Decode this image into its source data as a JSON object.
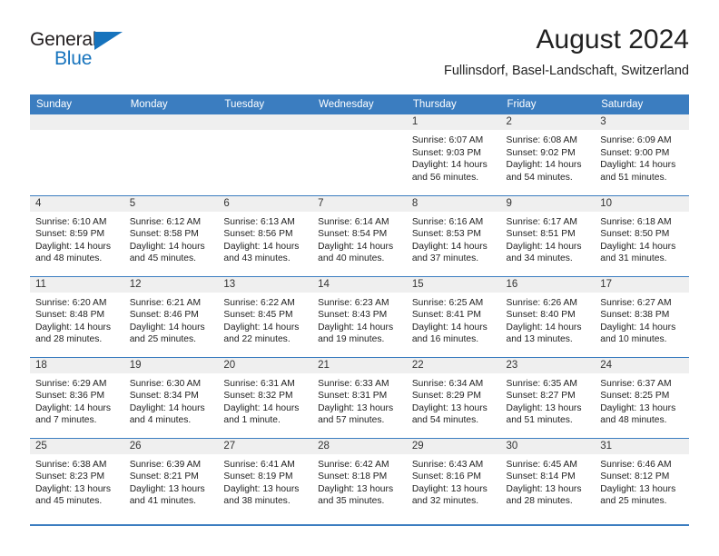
{
  "brand": {
    "name_part1": "General",
    "name_part2": "Blue",
    "triangle_color": "#1673bd"
  },
  "header": {
    "title": "August 2024",
    "subtitle": "Fullinsdorf, Basel-Landschaft, Switzerland"
  },
  "theme": {
    "header_bg": "#3b7dc0",
    "daynum_bg": "#efefef",
    "rule_color": "#3b7dc0"
  },
  "weekdays": [
    "Sunday",
    "Monday",
    "Tuesday",
    "Wednesday",
    "Thursday",
    "Friday",
    "Saturday"
  ],
  "labels": {
    "sunrise": "Sunrise:",
    "sunset": "Sunset:",
    "daylight": "Daylight:"
  },
  "weeks": [
    [
      {
        "blank": true
      },
      {
        "blank": true
      },
      {
        "blank": true
      },
      {
        "blank": true
      },
      {
        "day": "1",
        "sunrise": "Sunrise: 6:07 AM",
        "sunset": "Sunset: 9:03 PM",
        "daylight1": "Daylight: 14 hours",
        "daylight2": "and 56 minutes."
      },
      {
        "day": "2",
        "sunrise": "Sunrise: 6:08 AM",
        "sunset": "Sunset: 9:02 PM",
        "daylight1": "Daylight: 14 hours",
        "daylight2": "and 54 minutes."
      },
      {
        "day": "3",
        "sunrise": "Sunrise: 6:09 AM",
        "sunset": "Sunset: 9:00 PM",
        "daylight1": "Daylight: 14 hours",
        "daylight2": "and 51 minutes."
      }
    ],
    [
      {
        "day": "4",
        "sunrise": "Sunrise: 6:10 AM",
        "sunset": "Sunset: 8:59 PM",
        "daylight1": "Daylight: 14 hours",
        "daylight2": "and 48 minutes."
      },
      {
        "day": "5",
        "sunrise": "Sunrise: 6:12 AM",
        "sunset": "Sunset: 8:58 PM",
        "daylight1": "Daylight: 14 hours",
        "daylight2": "and 45 minutes."
      },
      {
        "day": "6",
        "sunrise": "Sunrise: 6:13 AM",
        "sunset": "Sunset: 8:56 PM",
        "daylight1": "Daylight: 14 hours",
        "daylight2": "and 43 minutes."
      },
      {
        "day": "7",
        "sunrise": "Sunrise: 6:14 AM",
        "sunset": "Sunset: 8:54 PM",
        "daylight1": "Daylight: 14 hours",
        "daylight2": "and 40 minutes."
      },
      {
        "day": "8",
        "sunrise": "Sunrise: 6:16 AM",
        "sunset": "Sunset: 8:53 PM",
        "daylight1": "Daylight: 14 hours",
        "daylight2": "and 37 minutes."
      },
      {
        "day": "9",
        "sunrise": "Sunrise: 6:17 AM",
        "sunset": "Sunset: 8:51 PM",
        "daylight1": "Daylight: 14 hours",
        "daylight2": "and 34 minutes."
      },
      {
        "day": "10",
        "sunrise": "Sunrise: 6:18 AM",
        "sunset": "Sunset: 8:50 PM",
        "daylight1": "Daylight: 14 hours",
        "daylight2": "and 31 minutes."
      }
    ],
    [
      {
        "day": "11",
        "sunrise": "Sunrise: 6:20 AM",
        "sunset": "Sunset: 8:48 PM",
        "daylight1": "Daylight: 14 hours",
        "daylight2": "and 28 minutes."
      },
      {
        "day": "12",
        "sunrise": "Sunrise: 6:21 AM",
        "sunset": "Sunset: 8:46 PM",
        "daylight1": "Daylight: 14 hours",
        "daylight2": "and 25 minutes."
      },
      {
        "day": "13",
        "sunrise": "Sunrise: 6:22 AM",
        "sunset": "Sunset: 8:45 PM",
        "daylight1": "Daylight: 14 hours",
        "daylight2": "and 22 minutes."
      },
      {
        "day": "14",
        "sunrise": "Sunrise: 6:23 AM",
        "sunset": "Sunset: 8:43 PM",
        "daylight1": "Daylight: 14 hours",
        "daylight2": "and 19 minutes."
      },
      {
        "day": "15",
        "sunrise": "Sunrise: 6:25 AM",
        "sunset": "Sunset: 8:41 PM",
        "daylight1": "Daylight: 14 hours",
        "daylight2": "and 16 minutes."
      },
      {
        "day": "16",
        "sunrise": "Sunrise: 6:26 AM",
        "sunset": "Sunset: 8:40 PM",
        "daylight1": "Daylight: 14 hours",
        "daylight2": "and 13 minutes."
      },
      {
        "day": "17",
        "sunrise": "Sunrise: 6:27 AM",
        "sunset": "Sunset: 8:38 PM",
        "daylight1": "Daylight: 14 hours",
        "daylight2": "and 10 minutes."
      }
    ],
    [
      {
        "day": "18",
        "sunrise": "Sunrise: 6:29 AM",
        "sunset": "Sunset: 8:36 PM",
        "daylight1": "Daylight: 14 hours",
        "daylight2": "and 7 minutes."
      },
      {
        "day": "19",
        "sunrise": "Sunrise: 6:30 AM",
        "sunset": "Sunset: 8:34 PM",
        "daylight1": "Daylight: 14 hours",
        "daylight2": "and 4 minutes."
      },
      {
        "day": "20",
        "sunrise": "Sunrise: 6:31 AM",
        "sunset": "Sunset: 8:32 PM",
        "daylight1": "Daylight: 14 hours",
        "daylight2": "and 1 minute."
      },
      {
        "day": "21",
        "sunrise": "Sunrise: 6:33 AM",
        "sunset": "Sunset: 8:31 PM",
        "daylight1": "Daylight: 13 hours",
        "daylight2": "and 57 minutes."
      },
      {
        "day": "22",
        "sunrise": "Sunrise: 6:34 AM",
        "sunset": "Sunset: 8:29 PM",
        "daylight1": "Daylight: 13 hours",
        "daylight2": "and 54 minutes."
      },
      {
        "day": "23",
        "sunrise": "Sunrise: 6:35 AM",
        "sunset": "Sunset: 8:27 PM",
        "daylight1": "Daylight: 13 hours",
        "daylight2": "and 51 minutes."
      },
      {
        "day": "24",
        "sunrise": "Sunrise: 6:37 AM",
        "sunset": "Sunset: 8:25 PM",
        "daylight1": "Daylight: 13 hours",
        "daylight2": "and 48 minutes."
      }
    ],
    [
      {
        "day": "25",
        "sunrise": "Sunrise: 6:38 AM",
        "sunset": "Sunset: 8:23 PM",
        "daylight1": "Daylight: 13 hours",
        "daylight2": "and 45 minutes."
      },
      {
        "day": "26",
        "sunrise": "Sunrise: 6:39 AM",
        "sunset": "Sunset: 8:21 PM",
        "daylight1": "Daylight: 13 hours",
        "daylight2": "and 41 minutes."
      },
      {
        "day": "27",
        "sunrise": "Sunrise: 6:41 AM",
        "sunset": "Sunset: 8:19 PM",
        "daylight1": "Daylight: 13 hours",
        "daylight2": "and 38 minutes."
      },
      {
        "day": "28",
        "sunrise": "Sunrise: 6:42 AM",
        "sunset": "Sunset: 8:18 PM",
        "daylight1": "Daylight: 13 hours",
        "daylight2": "and 35 minutes."
      },
      {
        "day": "29",
        "sunrise": "Sunrise: 6:43 AM",
        "sunset": "Sunset: 8:16 PM",
        "daylight1": "Daylight: 13 hours",
        "daylight2": "and 32 minutes."
      },
      {
        "day": "30",
        "sunrise": "Sunrise: 6:45 AM",
        "sunset": "Sunset: 8:14 PM",
        "daylight1": "Daylight: 13 hours",
        "daylight2": "and 28 minutes."
      },
      {
        "day": "31",
        "sunrise": "Sunrise: 6:46 AM",
        "sunset": "Sunset: 8:12 PM",
        "daylight1": "Daylight: 13 hours",
        "daylight2": "and 25 minutes."
      }
    ]
  ]
}
